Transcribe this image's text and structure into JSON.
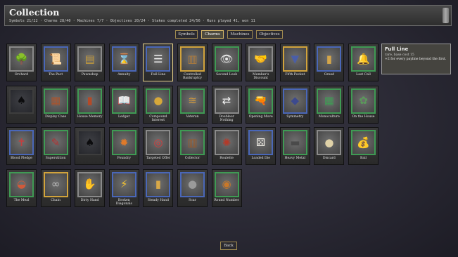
{
  "header": {
    "title": "Collection",
    "stats": "Symbols 21/22 · Charms 28/40 · Machines 7/7 · Objectives 20/24 · Stakes completed 24/56 · Runs played 41, won 11"
  },
  "tabs": [
    {
      "label": "Symbols",
      "active": false
    },
    {
      "label": "Charms",
      "active": true
    },
    {
      "label": "Machines",
      "active": false
    },
    {
      "label": "Objectives",
      "active": false
    }
  ],
  "charms": [
    {
      "label": "Orchard",
      "frame": "gray",
      "icon": "tree-icon",
      "glyph": "🌳",
      "color": "#8b5a2b"
    },
    {
      "label": "The Pact",
      "frame": "blue",
      "icon": "scroll-icon",
      "glyph": "📜",
      "color": "#d9c89a"
    },
    {
      "label": "Pawnshop",
      "frame": "gray",
      "icon": "chest-icon",
      "glyph": "▤",
      "color": "#c49a3a"
    },
    {
      "label": "Annuity",
      "frame": "blue",
      "icon": "hourglass-icon",
      "glyph": "⌛",
      "color": "#d8a948"
    },
    {
      "label": "Full Line",
      "frame": "blue",
      "icon": "stairs-icon",
      "glyph": "☰",
      "color": "#f2f2f2",
      "selected": true
    },
    {
      "label": "Controlled Bankruptcy",
      "frame": "gold",
      "icon": "sign-icon",
      "glyph": "▥",
      "color": "#b07b3a"
    },
    {
      "label": "Second Look",
      "frame": "green",
      "icon": "eye-icon",
      "glyph": "👁",
      "color": "#e8e8e8"
    },
    {
      "label": "Member's Discount",
      "frame": "gray",
      "icon": "handshake-icon",
      "glyph": "🤝",
      "color": "#e0b890"
    },
    {
      "label": "Fifth Pocket",
      "frame": "gold",
      "icon": "pocket-icon",
      "glyph": "▼",
      "color": "#4a5ea8"
    },
    {
      "label": "Greed",
      "frame": "blue",
      "icon": "pillar-icon",
      "glyph": "▮",
      "color": "#d4a64a"
    },
    {
      "label": "Last Call",
      "frame": "green",
      "icon": "bell-icon",
      "glyph": "🔔",
      "color": "#c8963c"
    },
    {
      "label": "",
      "frame": "dark",
      "icon": "locked-silhouette-icon",
      "glyph": "♠",
      "color": "#0c0c0e"
    },
    {
      "label": "Display Case",
      "frame": "green",
      "icon": "cabinet-icon",
      "glyph": "▦",
      "color": "#a8542e"
    },
    {
      "label": "House Memory",
      "frame": "green",
      "icon": "book-icon",
      "glyph": "▮",
      "color": "#b34a28"
    },
    {
      "label": "Ledger",
      "frame": "green",
      "icon": "open-book-icon",
      "glyph": "📖",
      "color": "#e6d4a8"
    },
    {
      "label": "Compound Interest",
      "frame": "green",
      "icon": "coin-bowl-icon",
      "glyph": "●",
      "color": "#d6a83a"
    },
    {
      "label": "Veteran",
      "frame": "green",
      "icon": "chevron-rank-icon",
      "glyph": "≋",
      "color": "#d49a3a"
    },
    {
      "label": "Doubleor Nothing",
      "frame": "gray",
      "icon": "arrows-icon",
      "glyph": "⇄",
      "color": "#f0f0f0"
    },
    {
      "label": "Opening Move",
      "frame": "green",
      "icon": "pistol-icon",
      "glyph": "🔫",
      "color": "#c28a4a"
    },
    {
      "label": "Symmetry",
      "frame": "blue",
      "icon": "wings-icon",
      "glyph": "◆",
      "color": "#3d4a8e"
    },
    {
      "label": "Monoculture",
      "frame": "green",
      "icon": "grid-icon",
      "glyph": "▦",
      "color": "#3f9a54"
    },
    {
      "label": "On the House",
      "frame": "green",
      "icon": "cake-icon",
      "glyph": "✿",
      "color": "#5a9a5a"
    },
    {
      "label": "Blood Pledge",
      "frame": "blue",
      "icon": "dagger-icon",
      "glyph": "✝",
      "color": "#c04040"
    },
    {
      "label": "Superstition",
      "frame": "green",
      "icon": "chili-icon",
      "glyph": "✎",
      "color": "#b33030"
    },
    {
      "label": "",
      "frame": "dark",
      "icon": "locked-silhouette-icon",
      "glyph": "♠",
      "color": "#0c0c0e"
    },
    {
      "label": "Foundry",
      "frame": "green",
      "icon": "anvil-flame-icon",
      "glyph": "✹",
      "color": "#e07a2a"
    },
    {
      "label": "Targeted Offer",
      "frame": "gray",
      "icon": "target-icon",
      "glyph": "◎",
      "color": "#d83a3a"
    },
    {
      "label": "Collector",
      "frame": "green",
      "icon": "cabinet-icon",
      "glyph": "▥",
      "color": "#9a5a2a"
    },
    {
      "label": "Roulette",
      "frame": "gray",
      "icon": "roulette-icon",
      "glyph": "✺",
      "color": "#b33a2a"
    },
    {
      "label": "Loaded Die",
      "frame": "blue",
      "icon": "die-icon",
      "glyph": "⚄",
      "color": "#f2efe6"
    },
    {
      "label": "Heavy Metal",
      "frame": "green",
      "icon": "anvil-icon",
      "glyph": "▬",
      "color": "#4a4a4a"
    },
    {
      "label": "Discard",
      "frame": "gray",
      "icon": "cookie-icon",
      "glyph": "●",
      "color": "#e0d2a8"
    },
    {
      "label": "Bail",
      "frame": "green",
      "icon": "money-bag-icon",
      "glyph": "💰",
      "color": "#b33a2a"
    },
    {
      "label": "The Meal",
      "frame": "green",
      "icon": "meal-icon",
      "glyph": "◒",
      "color": "#d05a3a"
    },
    {
      "label": "Chain",
      "frame": "gold",
      "icon": "chain-icon",
      "glyph": "∞",
      "color": "#b8b8b8"
    },
    {
      "label": "Dirty Hand",
      "frame": "gray",
      "icon": "hand-icon",
      "glyph": "✋",
      "color": "#c89a6a"
    },
    {
      "label": "Broken Diagonals",
      "frame": "blue",
      "icon": "lightning-icon",
      "glyph": "⚡",
      "color": "#f0c030"
    },
    {
      "label": "Steady Hand",
      "frame": "blue",
      "icon": "candle-icon",
      "glyph": "▮",
      "color": "#d8a848"
    },
    {
      "label": "Scar",
      "frame": "blue",
      "icon": "scar-icon",
      "glyph": "●",
      "color": "#9a9a9a"
    },
    {
      "label": "Round Number",
      "frame": "green",
      "icon": "coin-icon",
      "glyph": "◉",
      "color": "#c8782a"
    }
  ],
  "tooltip": {
    "title": "Full Line",
    "subtitle": "rare, base cost 15",
    "description": "+2 for every payline beyond the first."
  },
  "back_label": "Back",
  "colors": {
    "frame_blue": "#4a67b8",
    "frame_green": "#3f9a54",
    "frame_gold": "#d1a33c",
    "frame_gray": "#8a8a8a",
    "tab_border": "#a08a50"
  }
}
